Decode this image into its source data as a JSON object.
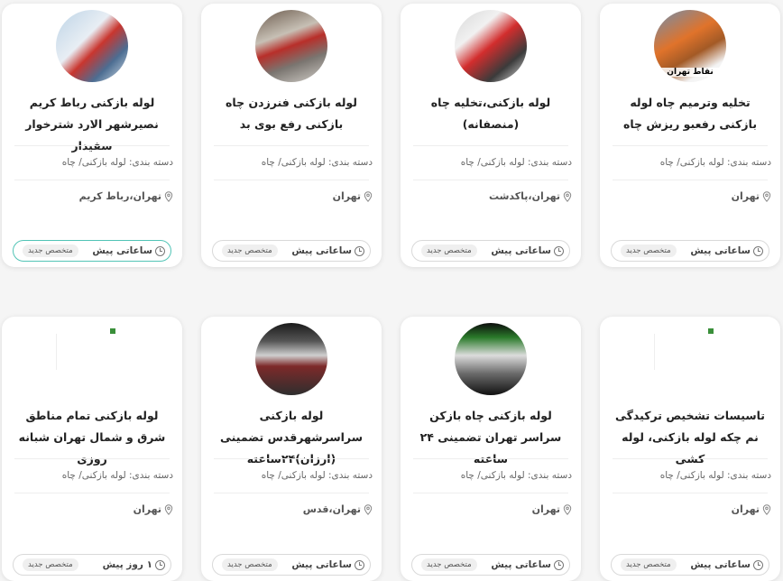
{
  "cards": [
    {
      "title": "تخلیه وترمیم چاه لوله بازکنی رفعبو ریزش چاه",
      "avatar_caption": "نقاط تهران",
      "category": "دسته بندی: لوله بازکنی/ چاه",
      "location": "تهران",
      "time": "ساعاتی پیش",
      "badge": "متخصص جدید"
    },
    {
      "title": "لوله بازکنی،تخلیه چاه (منصفانه)",
      "category": "دسته بندی: لوله بازکنی/ چاه",
      "location": "تهران،پاکدشت",
      "time": "ساعاتی پیش",
      "badge": "متخصص جدید"
    },
    {
      "title": "لوله بازکنی فنرزدن چاه بازکنی رفع بوی بد",
      "category": "دسته بندی: لوله بازکنی/ چاه",
      "location": "تهران",
      "time": "ساعاتی پیش",
      "badge": "متخصص جدید"
    },
    {
      "title": "لوله بازکنی رباط کریم نصیرشهر الارد شترخوار سفیدار",
      "category": "دسته بندی: لوله بازکنی/ چاه",
      "location": "تهران،رباط کریم",
      "time": "ساعاتی پیش",
      "badge": "متخصص جدید"
    },
    {
      "title": "تاسیسات تشخیص ترکیدگی نم چکه لوله بازکنی، لوله کشی",
      "category": "دسته بندی: لوله بازکنی/ چاه",
      "location": "تهران",
      "time": "ساعاتی پیش",
      "badge": "متخصص جدید"
    },
    {
      "title": "لوله بازکنی چاه بازکن سراسر تهران تضمینی ۲۴ ساعته",
      "category": "دسته بندی: لوله بازکنی/ چاه",
      "location": "تهران",
      "time": "ساعاتی پیش",
      "badge": "متخصص جدید"
    },
    {
      "title": "لوله بازکنی سراسرشهرقدس تضمینی (ارزان)۲۴ساعته",
      "category": "دسته بندی: لوله بازکنی/ چاه",
      "location": "تهران،قدس",
      "time": "ساعاتی پیش",
      "badge": "متخصص جدید"
    },
    {
      "title": "لوله بازکنی تمام مناطق شرق و شمال تهران شبانه روزی",
      "category": "دسته بندی: لوله بازکنی/ چاه",
      "location": "تهران",
      "time": "۱ روز پیش",
      "badge": "متخصص جدید"
    }
  ]
}
